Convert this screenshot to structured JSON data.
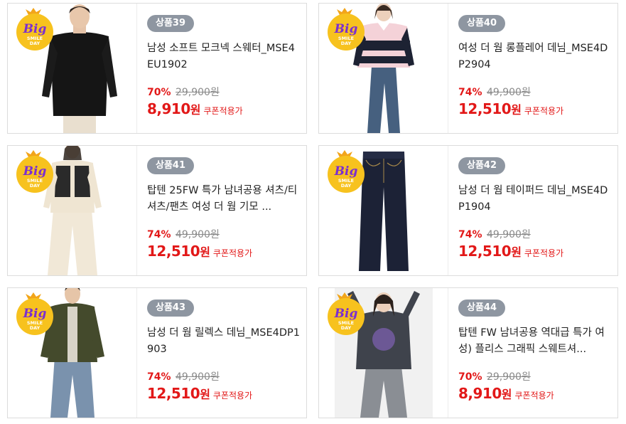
{
  "badge": {
    "big": "Big",
    "line1": "SMILE",
    "line2": "DAY"
  },
  "colors": {
    "accent_red": "#e21818",
    "rank_gray": "#8e96a1",
    "badge_yellow": "#f7c21e",
    "badge_purple": "#7b2fd0"
  },
  "products": [
    {
      "rank": "상품39",
      "title": "남성 소프트 모크넥 스웨터_MSE4EU1902",
      "discount": "70%",
      "original_price": "29,900원",
      "final_price": "8,910",
      "won": "원",
      "coupon": "쿠폰적용가"
    },
    {
      "rank": "상품40",
      "title": "여성 더 웜 롱플레어 데님_MSE4DP2904",
      "discount": "74%",
      "original_price": "49,900원",
      "final_price": "12,510",
      "won": "원",
      "coupon": "쿠폰적용가"
    },
    {
      "rank": "상품41",
      "title": "탑텐 25FW 특가 남녀공용 셔츠/티셔츠/팬츠 여성 더 웜 기모 ...",
      "discount": "74%",
      "original_price": "49,900원",
      "final_price": "12,510",
      "won": "원",
      "coupon": "쿠폰적용가"
    },
    {
      "rank": "상품42",
      "title": "남성 더 웜 테이퍼드 데님_MSE4DP1904",
      "discount": "74%",
      "original_price": "49,900원",
      "final_price": "12,510",
      "won": "원",
      "coupon": "쿠폰적용가"
    },
    {
      "rank": "상품43",
      "title": "남성 더 웜 릴렉스 데님_MSE4DP1903",
      "discount": "74%",
      "original_price": "49,900원",
      "final_price": "12,510",
      "won": "원",
      "coupon": "쿠폰적용가"
    },
    {
      "rank": "상품44",
      "title": "탑텐 FW 남녀공용 역대급 특가 여성) 플리스 그래픽 스웨트셔...",
      "discount": "70%",
      "original_price": "29,900원",
      "final_price": "8,910",
      "won": "원",
      "coupon": "쿠폰적용가"
    }
  ]
}
